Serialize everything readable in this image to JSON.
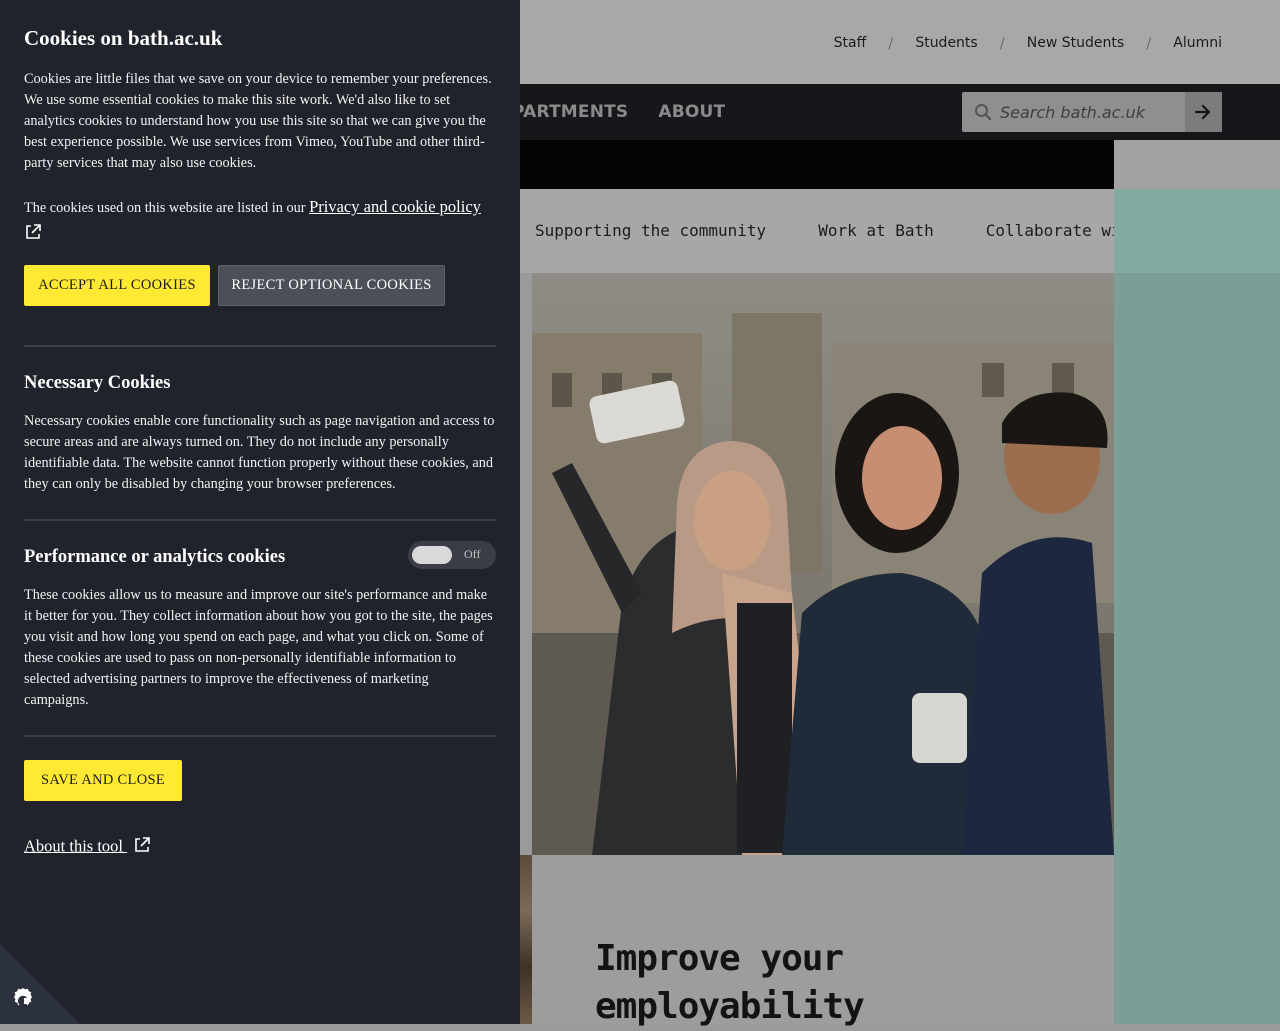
{
  "utility_nav": {
    "items": [
      "Staff",
      "Students",
      "New Students",
      "Alumni"
    ],
    "separator": "/"
  },
  "main_nav": {
    "items": [
      "PARTMENTS",
      "ABOUT"
    ]
  },
  "search": {
    "placeholder": "Search bath.ac.uk"
  },
  "sub_nav": {
    "items": [
      "Supporting the community",
      "Work at Bath",
      "Collaborate with us"
    ]
  },
  "promo": {
    "headline_line1": "Improve your",
    "headline_line2": "employability"
  },
  "cookie_panel": {
    "title": "Cookies on bath.ac.uk",
    "intro": "Cookies are little files that we save on your device to remember your preferences. We use some essential cookies to make this site work. We'd also like to set analytics cookies to understand how you use this site so that we can give you the best experience possible. We use services from Vimeo, YouTube and other third-party services that may also use cookies.",
    "policy_prefix": "The cookies used on this website are listed in our ",
    "policy_link": "Privacy and cookie policy",
    "accept_all": "ACCEPT ALL COOKIES",
    "reject_optional": "REJECT OPTIONAL COOKIES",
    "necessary": {
      "heading": "Necessary Cookies",
      "text": "Necessary cookies enable core functionality such as page navigation and access to secure areas and are always turned on. They do not include any personally identifiable data. The website cannot function properly without these cookies, and they can only be disabled by changing your browser preferences."
    },
    "analytics": {
      "heading": "Performance or analytics cookies",
      "toggle_state": "Off",
      "text": "These cookies allow us to measure and improve our site's performance and make it better for you. They collect information about how you got to the site, the pages you visit and how long you spend on each page, and what you click on. Some of these cookies are used to pass on non-personally identifiable information to selected advertising partners to improve the effectiveness of marketing campaigns."
    },
    "save_close": "SAVE AND CLOSE",
    "about_tool": "About this tool"
  },
  "colors": {
    "panel_bg": "#20232b",
    "accent_yellow": "#ffe933",
    "secondary_button": "#4b4f57",
    "teal": "#7b9f97"
  },
  "icons": [
    "search-icon",
    "arrow-right-icon",
    "external-link-icon",
    "cookie-icon"
  ]
}
